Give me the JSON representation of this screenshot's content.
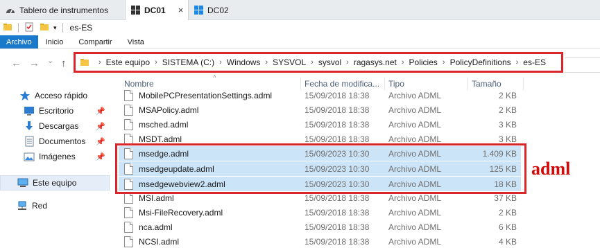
{
  "tabs": [
    {
      "label": "Tablero de instrumentos",
      "icon": "dashboard-icon",
      "active": false
    },
    {
      "label": "DC01",
      "icon": "windows-icon",
      "active": true,
      "close": "×"
    },
    {
      "label": "DC02",
      "icon": "windows-icon",
      "active": false
    }
  ],
  "qat": {
    "title": "es-ES"
  },
  "ribbon": {
    "tabs": [
      "Archivo",
      "Inicio",
      "Compartir",
      "Vista"
    ]
  },
  "nav": {
    "back": "←",
    "forward": "→",
    "recent": "⌄",
    "up": "↑"
  },
  "breadcrumb": [
    "Este equipo",
    "SISTEMA (C:)",
    "Windows",
    "SYSVOL",
    "sysvol",
    "ragasys.net",
    "Policies",
    "PolicyDefinitions",
    "es-ES"
  ],
  "crumb_sep": "›",
  "sidebar": {
    "items": [
      {
        "label": "Acceso rápido",
        "icon": "star-icon",
        "pinned": false
      },
      {
        "label": "Escritorio",
        "icon": "desktop-icon",
        "pinned": true
      },
      {
        "label": "Descargas",
        "icon": "download-icon",
        "pinned": true
      },
      {
        "label": "Documentos",
        "icon": "documents-icon",
        "pinned": true
      },
      {
        "label": "Imágenes",
        "icon": "images-icon",
        "pinned": true
      },
      {
        "label": "Este equipo",
        "icon": "computer-icon",
        "pinned": false,
        "selected": true
      },
      {
        "label": "Red",
        "icon": "network-icon",
        "pinned": false
      }
    ]
  },
  "columns": {
    "name": "Nombre",
    "date": "Fecha de modifica...",
    "type": "Tipo",
    "size": "Tamaño"
  },
  "files": [
    {
      "name": "MobilePCPresentationSettings.adml",
      "date": "15/09/2018 18:38",
      "type": "Archivo ADML",
      "size": "2 KB",
      "highlight": false
    },
    {
      "name": "MSAPolicy.adml",
      "date": "15/09/2018 18:38",
      "type": "Archivo ADML",
      "size": "2 KB",
      "highlight": false
    },
    {
      "name": "msched.adml",
      "date": "15/09/2018 18:38",
      "type": "Archivo ADML",
      "size": "3 KB",
      "highlight": false
    },
    {
      "name": "MSDT.adml",
      "date": "15/09/2018 18:38",
      "type": "Archivo ADML",
      "size": "3 KB",
      "highlight": false
    },
    {
      "name": "msedge.adml",
      "date": "15/09/2023 10:30",
      "type": "Archivo ADML",
      "size": "1.409 KB",
      "highlight": true
    },
    {
      "name": "msedgeupdate.adml",
      "date": "15/09/2023 10:30",
      "type": "Archivo ADML",
      "size": "125 KB",
      "highlight": true
    },
    {
      "name": "msedgewebview2.adml",
      "date": "15/09/2023 10:30",
      "type": "Archivo ADML",
      "size": "18 KB",
      "highlight": true
    },
    {
      "name": "MSI.adml",
      "date": "15/09/2018 18:38",
      "type": "Archivo ADML",
      "size": "37 KB",
      "highlight": false
    },
    {
      "name": "Msi-FileRecovery.adml",
      "date": "15/09/2018 18:38",
      "type": "Archivo ADML",
      "size": "2 KB",
      "highlight": false
    },
    {
      "name": "nca.adml",
      "date": "15/09/2018 18:38",
      "type": "Archivo ADML",
      "size": "6 KB",
      "highlight": false
    },
    {
      "name": "NCSI.adml",
      "date": "15/09/2018 18:38",
      "type": "Archivo ADML",
      "size": "4 KB",
      "highlight": false
    }
  ],
  "annotation": "adml",
  "colors": {
    "accent": "#1979ca",
    "highlight": "#cce4f7",
    "annotation": "#d10a0a",
    "box": "#d9262b"
  }
}
